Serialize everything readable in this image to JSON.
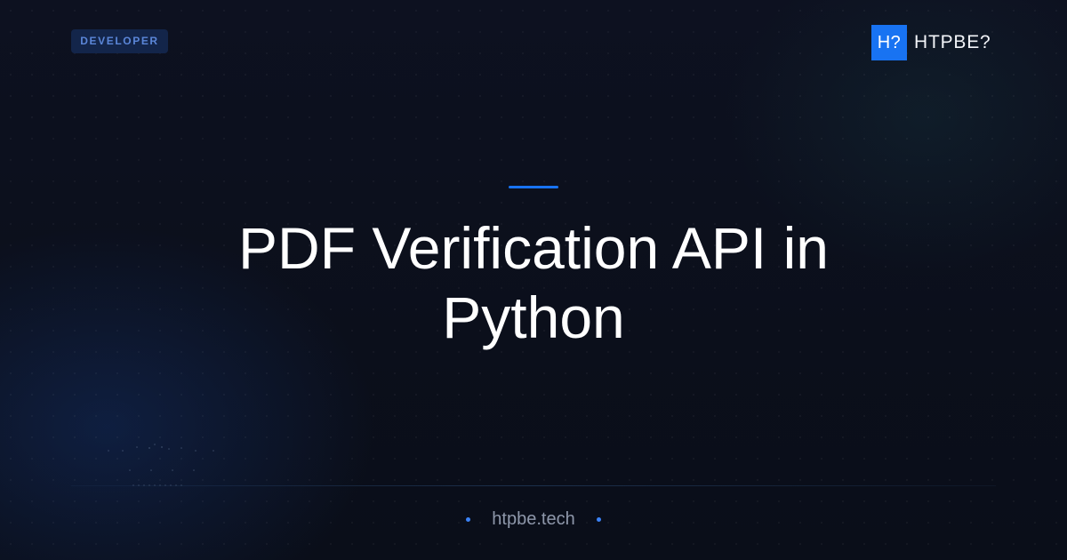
{
  "badge": {
    "label": "DEVELOPER"
  },
  "brand": {
    "mark": "H?",
    "name": "HTPBE?",
    "accent_color": "#1873f2"
  },
  "title": {
    "line1": "PDF Verification API in",
    "line2": "Python"
  },
  "footer": {
    "url": "htpbe.tech"
  },
  "colors": {
    "background": "#0b0f1c",
    "accent": "#1873f2",
    "badge_bg": "#13254a",
    "badge_text": "#5b86d8"
  }
}
